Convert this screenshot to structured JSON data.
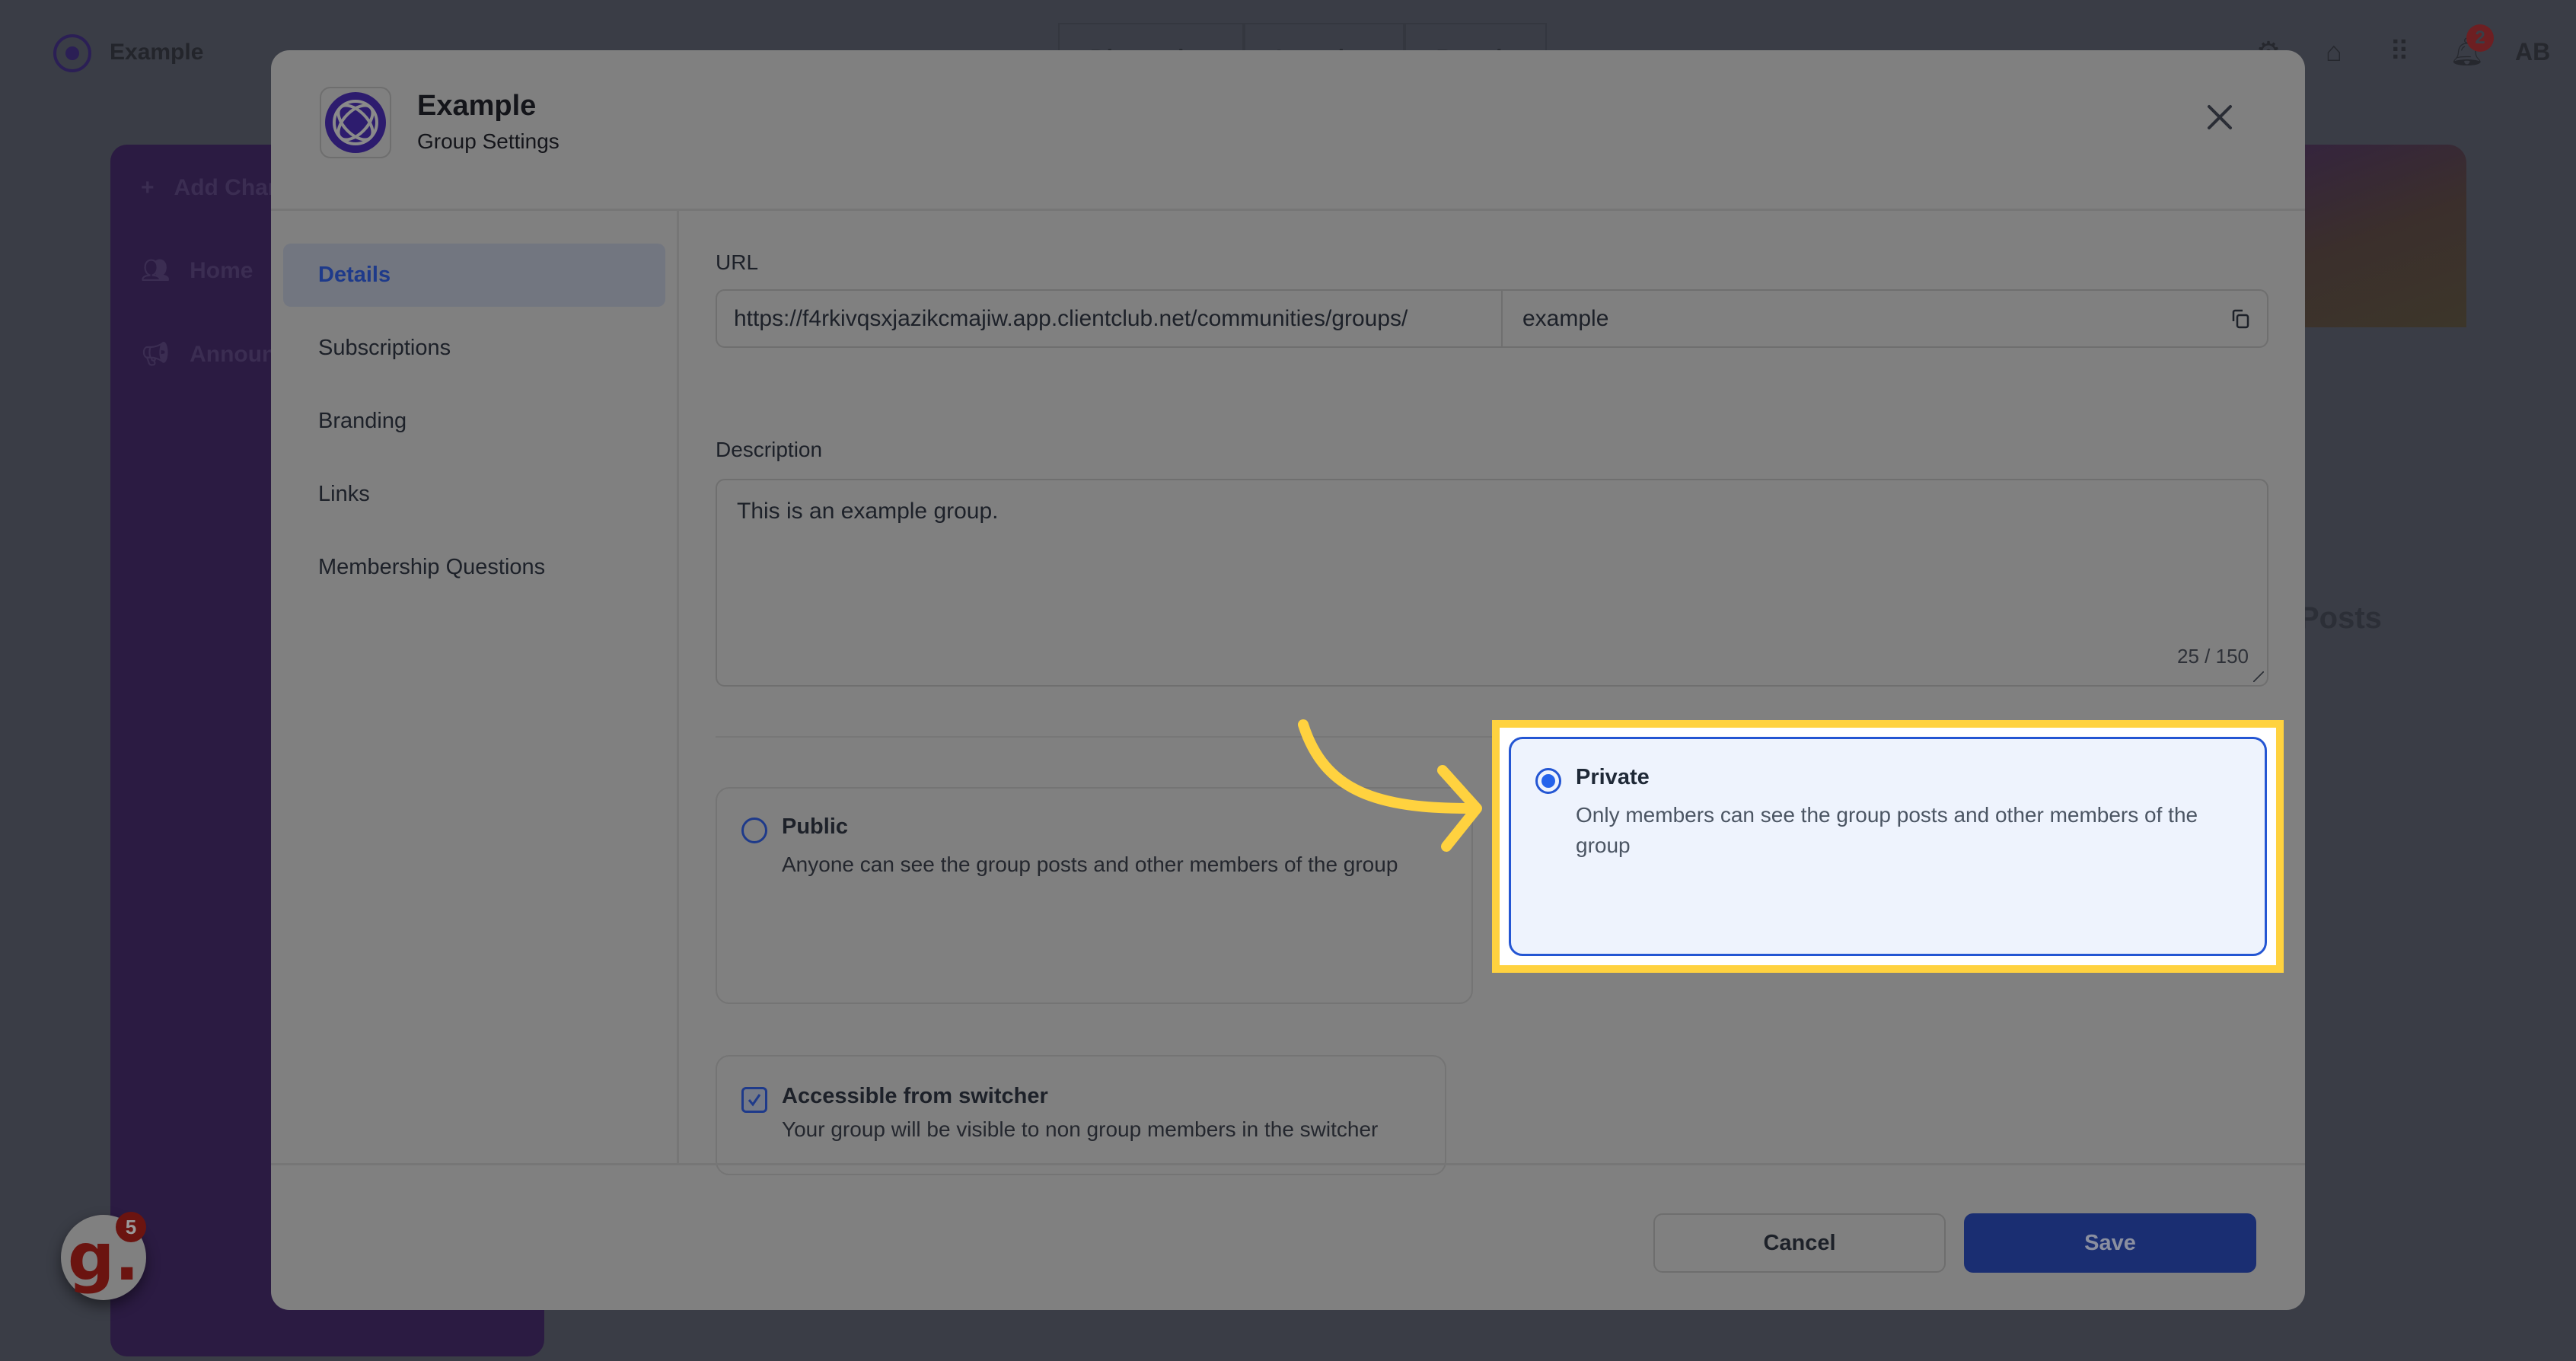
{
  "background": {
    "brand": "Example",
    "top_tabs": [
      "Discussion",
      "Learning",
      "Brands"
    ],
    "notification_count": "2",
    "avatar_initials": "AB",
    "sidebar": {
      "add_channel": "Add Channel",
      "items": [
        "Home",
        "Announcements"
      ]
    },
    "posts_heading": "Posts"
  },
  "widget": {
    "letter": "g.",
    "badge": "5"
  },
  "modal": {
    "title": "Example",
    "subtitle": "Group Settings",
    "nav": [
      {
        "label": "Details",
        "active": true
      },
      {
        "label": "Subscriptions",
        "active": false
      },
      {
        "label": "Branding",
        "active": false
      },
      {
        "label": "Links",
        "active": false
      },
      {
        "label": "Membership Questions",
        "active": false
      }
    ],
    "url": {
      "label": "URL",
      "prefix": "https://f4rkivqsxjazikcmajiw.app.clientclub.net/communities/groups/",
      "slug": "example"
    },
    "description": {
      "label": "Description",
      "value": "This is an example group.",
      "count": "25 / 150"
    },
    "visibility": {
      "selected": "private",
      "options": [
        {
          "id": "public",
          "title": "Public",
          "description": "Anyone can see the group posts and other members of the group"
        },
        {
          "id": "private",
          "title": "Private",
          "description": "Only members can see the group posts and other members of the group"
        }
      ]
    },
    "switcher": {
      "checked": true,
      "title": "Accessible from switcher",
      "description": "Your group will be visible to non group members in the switcher"
    },
    "footer": {
      "cancel": "Cancel",
      "save": "Save"
    }
  },
  "colors": {
    "accent": "#2563eb",
    "save_button": "#1a2e72",
    "highlight": "#ffd23f",
    "logo_purple": "#2b1f55"
  }
}
